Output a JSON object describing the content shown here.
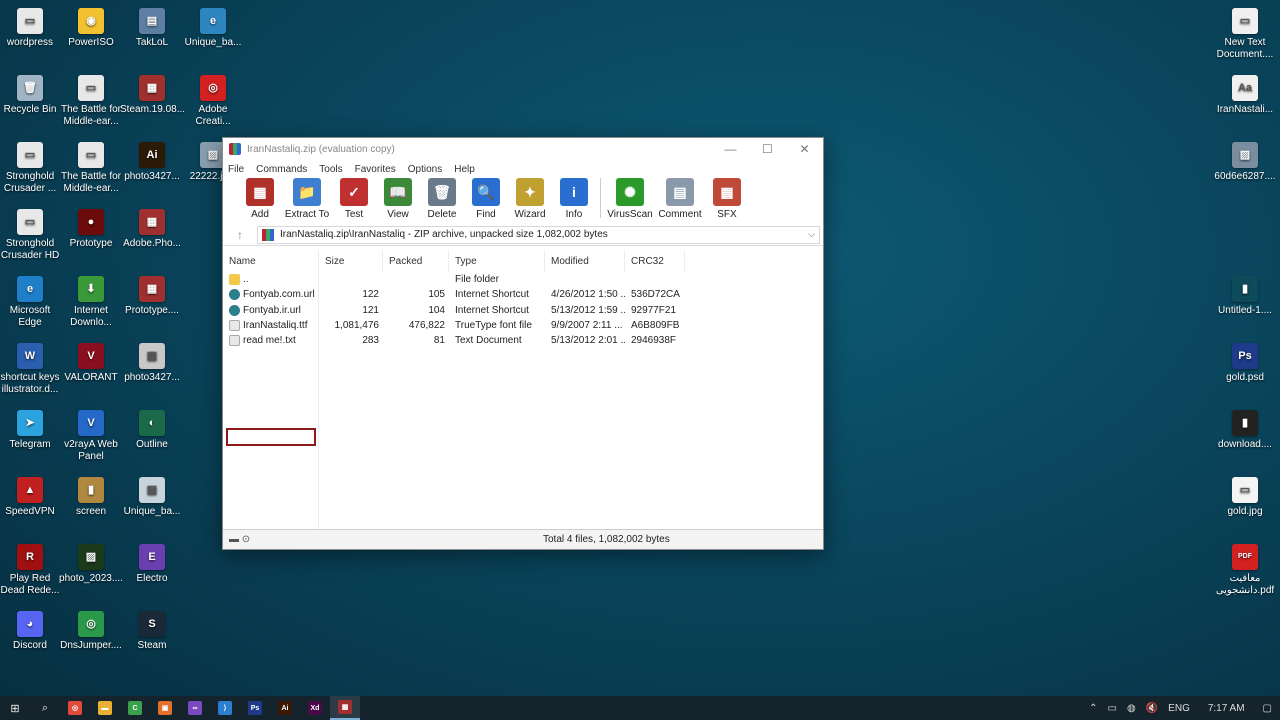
{
  "desktop": {
    "icons_left": [
      {
        "label": "wordpress",
        "color": "#e8e8e8",
        "glyph": "▭"
      },
      {
        "label": "PowerISO",
        "color": "#f2c230",
        "glyph": "◉"
      },
      {
        "label": "TakLoL",
        "color": "#5c7fa3",
        "glyph": "▤"
      },
      {
        "label": "Unique_ba...",
        "color": "#2e86c1",
        "glyph": "e"
      },
      {
        "label": "Recycle Bin",
        "color": "#9fb4c4",
        "glyph": "🗑"
      },
      {
        "label": "The Battle for Middle-ear...",
        "color": "#e8e8e8",
        "glyph": "▭"
      },
      {
        "label": "Steam.19.08....",
        "color": "#a03030",
        "glyph": "▦"
      },
      {
        "label": "Adobe Creati...",
        "color": "#d32020",
        "glyph": "◎"
      },
      {
        "label": "Stronghold Crusader ...",
        "color": "#e8e8e8",
        "glyph": "▭"
      },
      {
        "label": "The Battle for Middle-ear...",
        "color": "#e8e8e8",
        "glyph": "▭"
      },
      {
        "label": "photo3427...",
        "color": "#2b1a05",
        "glyph": "Ai"
      },
      {
        "label": "22222.jp...",
        "color": "#8aa0b0",
        "glyph": "▨"
      },
      {
        "label": "Stronghold Crusader HD",
        "color": "#e8e8e8",
        "glyph": "▭"
      },
      {
        "label": "Prototype",
        "color": "#6b0b0b",
        "glyph": "●"
      },
      {
        "label": "Adobe.Pho...",
        "color": "#a03030",
        "glyph": "▦"
      },
      {
        "label": "Microsoft Edge",
        "color": "#1f7fc9",
        "glyph": "e"
      },
      {
        "label": "Internet Downlo...",
        "color": "#3a9a3a",
        "glyph": "⬇"
      },
      {
        "label": "Prototype....",
        "color": "#a03030",
        "glyph": "▦"
      },
      {
        "label": "shortcut keys illustrator.d...",
        "color": "#2a5fb0",
        "glyph": "W"
      },
      {
        "label": "VALORANT",
        "color": "#8a1020",
        "glyph": "V"
      },
      {
        "label": "photo3427...",
        "color": "#c8c8c8",
        "glyph": "▨"
      },
      {
        "label": "Telegram",
        "color": "#2aa3df",
        "glyph": "➤"
      },
      {
        "label": "v2rayA Web Panel",
        "color": "#2469c7",
        "glyph": "V"
      },
      {
        "label": "Outline",
        "color": "#1a6a4a",
        "glyph": "◐"
      },
      {
        "label": "SpeedVPN",
        "color": "#c02020",
        "glyph": "▲"
      },
      {
        "label": "screen",
        "color": "#b08840",
        "glyph": "▮"
      },
      {
        "label": "Unique_ba...",
        "color": "#c8d4dc",
        "glyph": "▨"
      },
      {
        "label": "Play Red Dead Rede...",
        "color": "#a01010",
        "glyph": "R"
      },
      {
        "label": "photo_2023....",
        "color": "#1a3a1a",
        "glyph": "▨"
      },
      {
        "label": "Electro",
        "color": "#6b3fb0",
        "glyph": "E"
      },
      {
        "label": "Discord",
        "color": "#5865f2",
        "glyph": "◕"
      },
      {
        "label": "DnsJumper....",
        "color": "#2a9a4a",
        "glyph": "◎"
      },
      {
        "label": "Steam",
        "color": "#1b2838",
        "glyph": "S"
      }
    ],
    "icons_right": [
      {
        "label": "New Text Document....",
        "color": "#f0f0f0",
        "glyph": "▭"
      },
      {
        "label": "IranNastali...",
        "color": "#f0f0f0",
        "glyph": "Aa"
      },
      {
        "label": "60d6e6287....",
        "color": "#7a8ea0",
        "glyph": "▨"
      },
      {
        "label": "Untitled-1....",
        "color": "#0d4a5a",
        "glyph": "▮"
      },
      {
        "label": "gold.psd",
        "color": "#1e3a8a",
        "glyph": "Ps"
      },
      {
        "label": "download....",
        "color": "#222222",
        "glyph": "▮"
      },
      {
        "label": "gold.jpg",
        "color": "#f4f4f4",
        "glyph": "▭"
      },
      {
        "label": "معافیت دانشجویی.pdf",
        "color": "#d32020",
        "glyph": "PDF"
      }
    ]
  },
  "window": {
    "title": "IranNastaliq.zip (evaluation copy)",
    "menu": [
      "File",
      "Commands",
      "Tools",
      "Favorites",
      "Options",
      "Help"
    ],
    "toolbar": [
      {
        "label": "Add",
        "color": "#b0302a",
        "glyph": "▦"
      },
      {
        "label": "Extract To",
        "color": "#3f7fcf",
        "glyph": "📁"
      },
      {
        "label": "Test",
        "color": "#c03030",
        "glyph": "✓"
      },
      {
        "label": "View",
        "color": "#3a8a3a",
        "glyph": "📖"
      },
      {
        "label": "Delete",
        "color": "#6a7a8a",
        "glyph": "🗑"
      },
      {
        "label": "Find",
        "color": "#2a6fd0",
        "glyph": "🔍"
      },
      {
        "label": "Wizard",
        "color": "#c0a030",
        "glyph": "✦"
      },
      {
        "label": "Info",
        "color": "#2a6fd0",
        "glyph": "i"
      },
      {
        "label": "VirusScan",
        "color": "#2a9a2a",
        "glyph": "✺"
      },
      {
        "label": "Comment",
        "color": "#8a9aaa",
        "glyph": "▤"
      },
      {
        "label": "SFX",
        "color": "#c04a3a",
        "glyph": "▦"
      }
    ],
    "address": "IranNastaliq.zip\\IranNastaliq - ZIP archive, unpacked size 1,082,002 bytes",
    "columns": {
      "name": "Name",
      "size": "Size",
      "packed": "Packed",
      "type": "Type",
      "modified": "Modified",
      "crc": "CRC32"
    },
    "files": [
      {
        "name": "..",
        "size": "",
        "packed": "",
        "type": "File folder",
        "modified": "",
        "crc": "",
        "icon_color": "#f3c94a"
      },
      {
        "name": "Fontyab.com.url",
        "size": "122",
        "packed": "105",
        "type": "Internet Shortcut",
        "modified": "4/26/2012 1:50 ...",
        "crc": "536D72CA",
        "icon_color": "#2a7f8a"
      },
      {
        "name": "Fontyab.ir.url",
        "size": "121",
        "packed": "104",
        "type": "Internet Shortcut",
        "modified": "5/13/2012 1:59 ...",
        "crc": "92977F21",
        "icon_color": "#2a7f8a"
      },
      {
        "name": "IranNastaliq.ttf",
        "size": "1,081,476",
        "packed": "476,822",
        "type": "TrueType font file",
        "modified": "9/9/2007 2:11 ...",
        "crc": "A6B809FB",
        "icon_color": "#e8e8e8"
      },
      {
        "name": "read me!.txt",
        "size": "283",
        "packed": "81",
        "type": "Text Document",
        "modified": "5/13/2012 2:01 ...",
        "crc": "2946938F",
        "icon_color": "#e8e8e8"
      }
    ],
    "status": "Total 4 files, 1,082,002 bytes"
  },
  "taskbar": {
    "apps": [
      {
        "name": "chrome",
        "color": "#e04a3a",
        "glyph": "◎"
      },
      {
        "name": "file-explorer",
        "color": "#e8b030",
        "glyph": "▬"
      },
      {
        "name": "camtasia",
        "color": "#3aa04a",
        "glyph": "C"
      },
      {
        "name": "app-orange",
        "color": "#e0702a",
        "glyph": "▣"
      },
      {
        "name": "visual-studio",
        "color": "#7a4ac0",
        "glyph": "∞"
      },
      {
        "name": "vscode",
        "color": "#2a7fd0",
        "glyph": "⟩"
      },
      {
        "name": "photoshop",
        "color": "#1e3a8a",
        "glyph": "Ps"
      },
      {
        "name": "illustrator",
        "color": "#3a1a05",
        "glyph": "Ai"
      },
      {
        "name": "xd",
        "color": "#4a0a4a",
        "glyph": "Xd"
      },
      {
        "name": "winrar",
        "color": "#a03030",
        "glyph": "▦"
      }
    ],
    "lang": "ENG",
    "time": "7:17 AM"
  }
}
